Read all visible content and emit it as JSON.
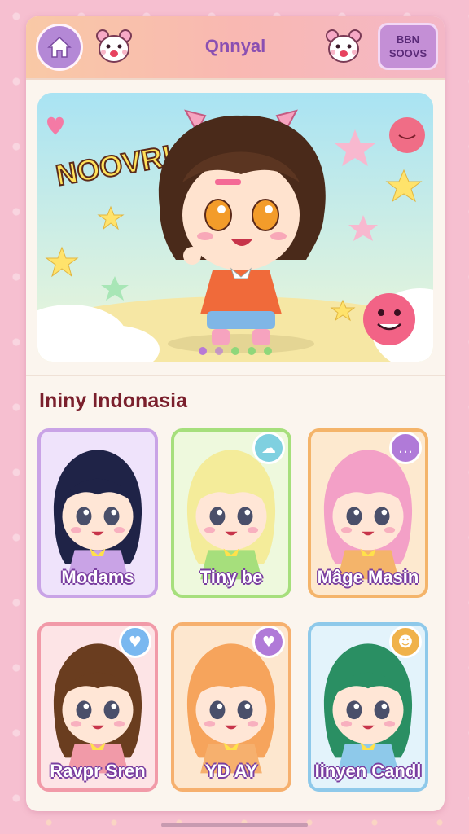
{
  "header": {
    "title": "Qnnyal",
    "menu_line1": "BBN",
    "menu_line2": "SOOVS",
    "home_icon": "home-icon",
    "mascot_icon": "bear-mascot-icon"
  },
  "banner": {
    "headline": "NOOVR!",
    "page_dots": 5,
    "active_dot": 0,
    "colors": {
      "sky": "#bfe7f4",
      "ground": "#f5e6a8",
      "dot_active": "#b87ad6",
      "dot_inactive": "#8fd77a"
    }
  },
  "section": {
    "title": "Ininy Indonasia"
  },
  "characters": [
    {
      "name": "Modams",
      "border": "#c9a3e6",
      "bg": "#efe3fb",
      "hair": "#1f2347",
      "badge": null
    },
    {
      "name": "Tiny be",
      "border": "#a6df7c",
      "bg": "#eef9dd",
      "hair": "#f4ec9a",
      "badge": "slime-icon"
    },
    {
      "name": "Mâge Masin",
      "border": "#f4b46a",
      "bg": "#fde9cf",
      "hair": "#f3a0c7",
      "badge": "chat-icon"
    },
    {
      "name": "Ravpr Sren",
      "border": "#f19aa8",
      "bg": "#fde4e6",
      "hair": "#6a3d1f",
      "badge": "heart-icon"
    },
    {
      "name": "YD AY",
      "border": "#f6b06e",
      "bg": "#fde7cf",
      "hair": "#f6a45c",
      "badge": "heart-bubble-icon"
    },
    {
      "name": "Iinyen Candl",
      "border": "#8ec9ea",
      "bg": "#e3f3fb",
      "hair": "#2a8f63",
      "badge": "monster-icon"
    }
  ]
}
